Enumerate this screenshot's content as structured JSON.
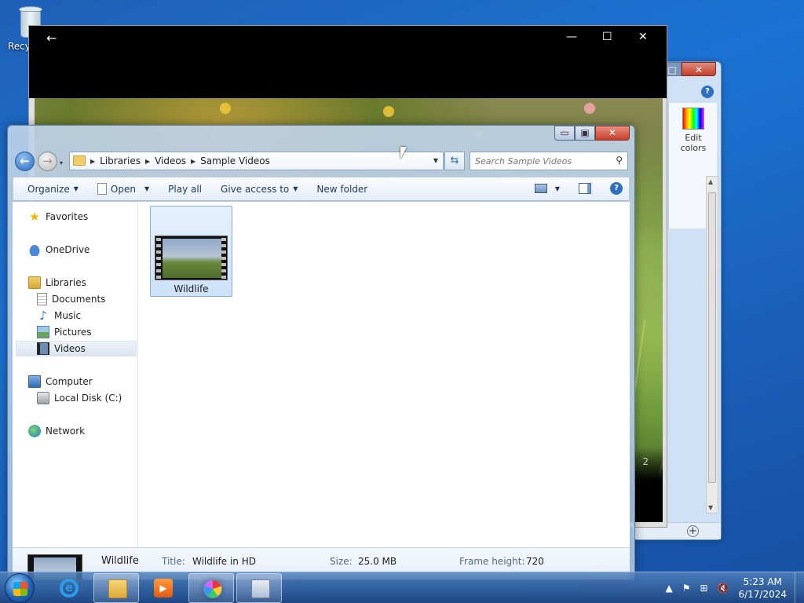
{
  "desktop": {
    "recycle_bin_label": "Recy"
  },
  "paint_window": {
    "minimize_glyph": "□",
    "close_glyph": "✕",
    "help_glyph": "?",
    "edit_colors_label": "Edit colors",
    "zoom_in_glyph": "+"
  },
  "player_window": {
    "back_glyph": "←",
    "minimize_glyph": "—",
    "maximize_glyph": "☐",
    "close_glyph": "✕",
    "timecode_partial": "2"
  },
  "explorer": {
    "controls": {
      "minimize": "▭",
      "maximize": "▣",
      "close": "✕"
    },
    "nav": {
      "back_glyph": "←",
      "forward_glyph": "→",
      "dropdown_glyph": "▾"
    },
    "breadcrumbs": [
      "Libraries",
      "Videos",
      "Sample Videos"
    ],
    "refresh_glyph": "⇆",
    "search": {
      "placeholder": "Search Sample Videos",
      "value": "",
      "icon": "magnifier-icon"
    },
    "toolbar": {
      "organize": "Organize",
      "open": "Open",
      "play_all": "Play all",
      "give_access": "Give access to",
      "new_folder": "New folder",
      "help_glyph": "?"
    },
    "nav_pane": {
      "favorites": "Favorites",
      "onedrive": "OneDrive",
      "libraries": "Libraries",
      "documents": "Documents",
      "music": "Music",
      "pictures": "Pictures",
      "videos": "Videos",
      "computer": "Computer",
      "local_disk": "Local Disk (C:)",
      "network": "Network"
    },
    "files": [
      {
        "name": "Wildlife",
        "type": "video",
        "selected": true
      }
    ],
    "details": {
      "name": "Wildlife",
      "title_label": "Title:",
      "title_value": "Wildlife in HD",
      "size_label": "Size:",
      "size_value": "25.0 MB",
      "frame_height_label": "Frame height:",
      "frame_height_value": "720"
    }
  },
  "taskbar": {
    "apps": [
      "internet-explorer",
      "windows-explorer",
      "windows-media-player",
      "paint",
      "movie-maker"
    ],
    "active_app": "windows-explorer",
    "tray": {
      "show_hidden_glyph": "▲",
      "flag_glyph": "⚑",
      "network_glyph": "⊞",
      "volume_glyph": "🔇"
    },
    "time": "5:23 AM",
    "date": "6/17/2024"
  },
  "colors": {
    "desktop": "#1c73d3",
    "selection": "#cde2fb",
    "close_button": "#c83d27"
  }
}
